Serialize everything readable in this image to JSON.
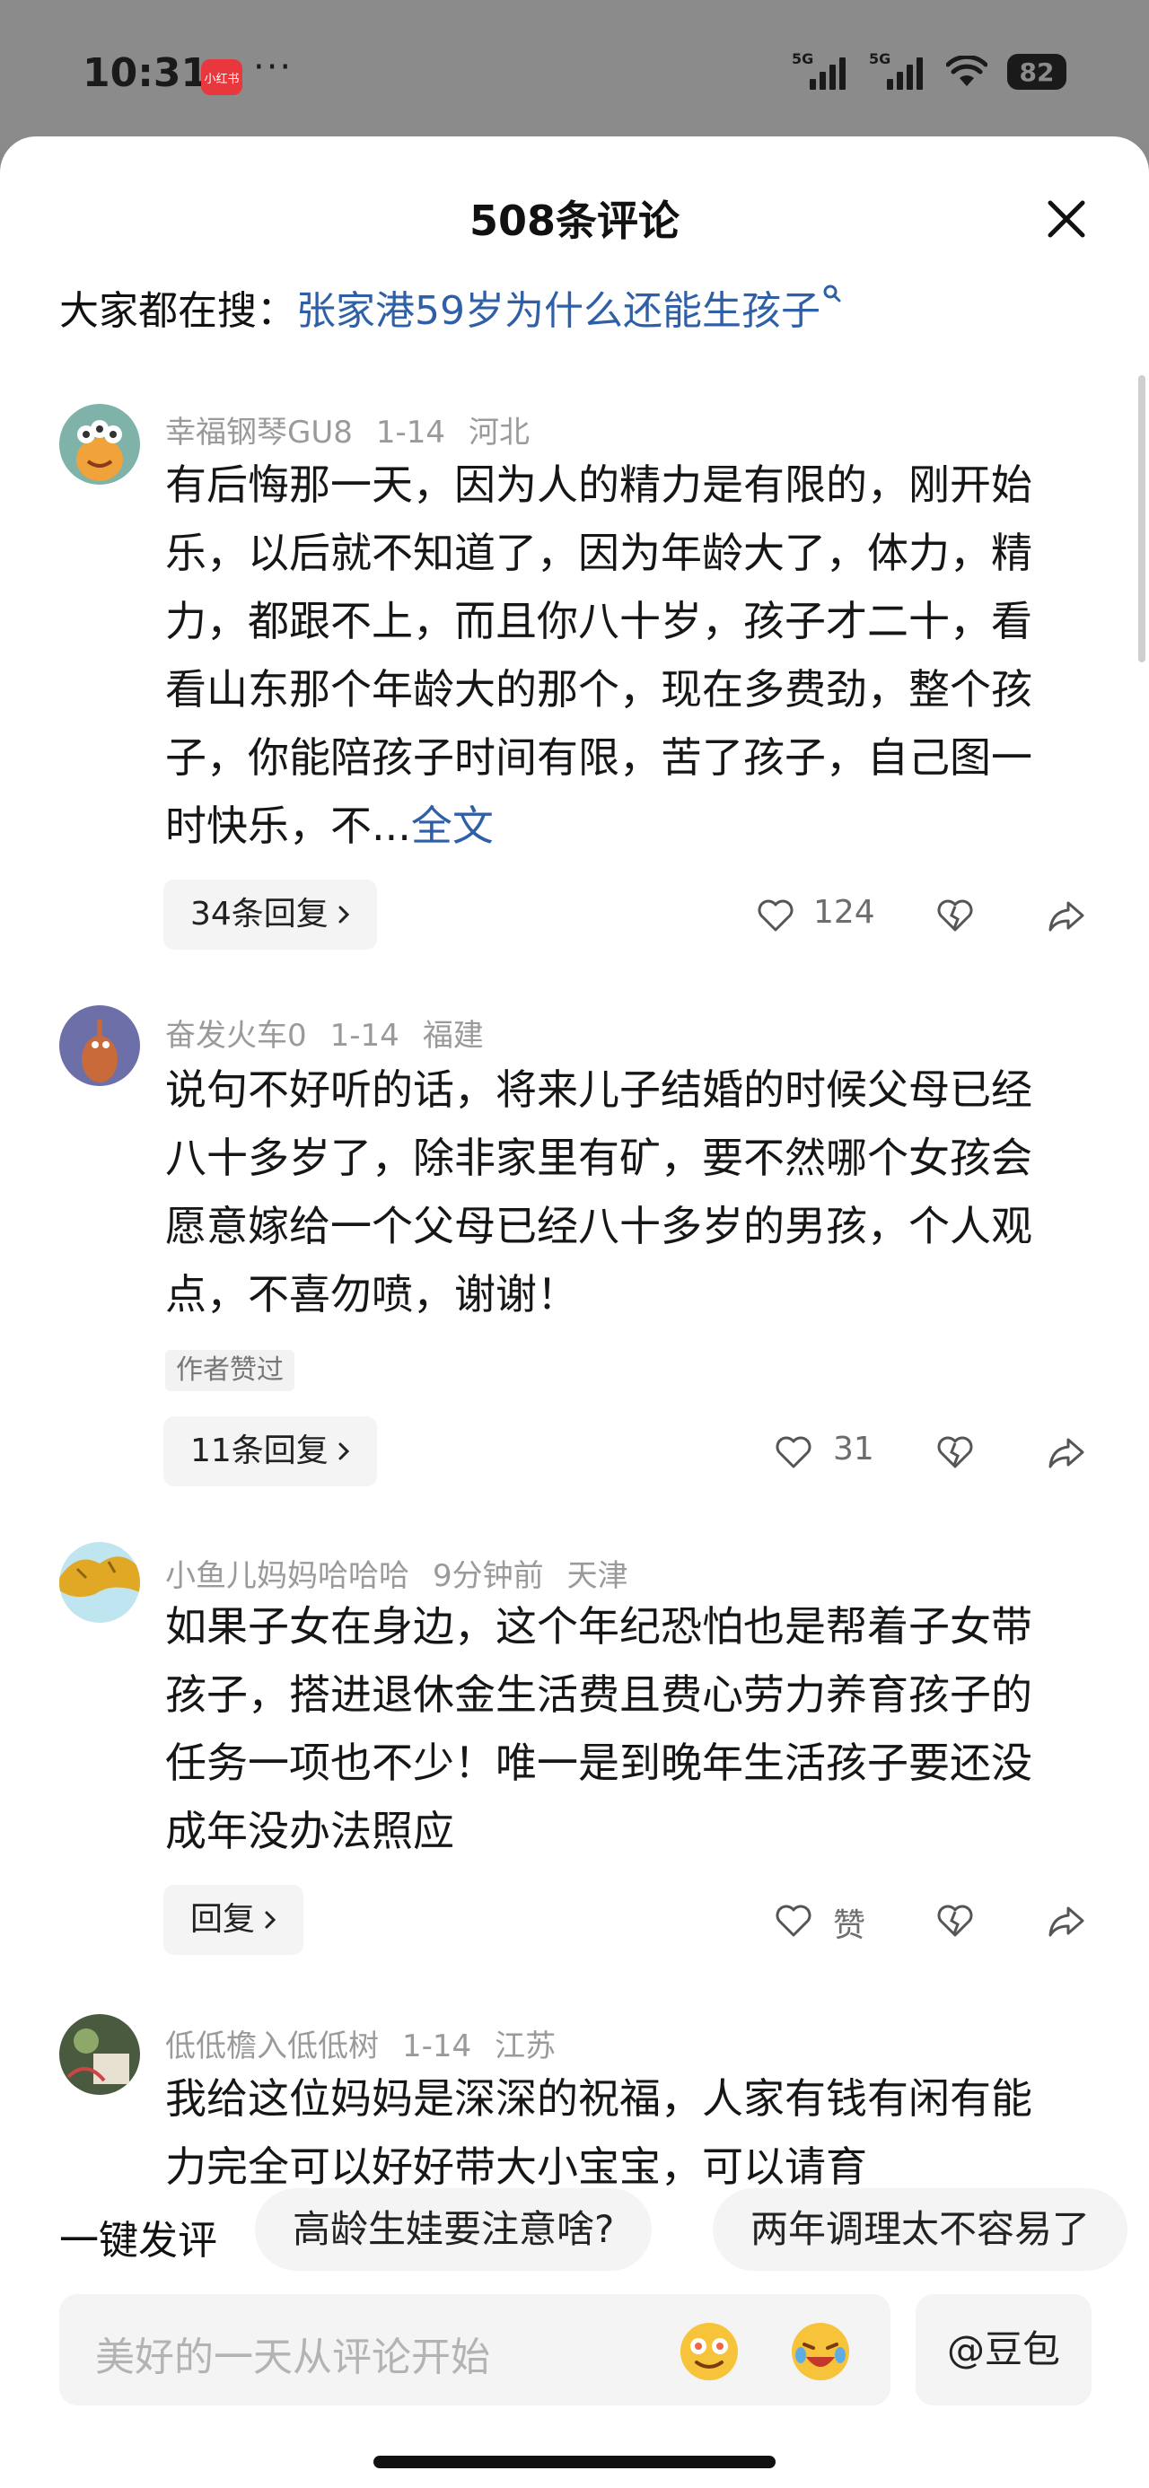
{
  "status_bar": {
    "time": "10:31",
    "app_badge": "小红书",
    "more": "···",
    "signal1_label": "5G",
    "signal2_label": "5G",
    "battery": "82"
  },
  "sheet": {
    "title": "508条评论",
    "search_prefix": "大家都在搜：",
    "search_link": "张家港59岁为什么还能生孩子"
  },
  "comments": [
    {
      "user": "幸福钢琴GU8",
      "date": "1-14",
      "location": "河北",
      "text": "有后悔那一天，因为人的精力是有限的，刚开始乐，以后就不知道了，因为年龄大了，体力，精力，都跟不上，而且你八十岁，孩子才二十，看看山东那个年龄大的那个，现在多费劲，整个孩子，你能陪孩子时间有限，苦了孩子，自己图一时快乐，不...",
      "more": "全文",
      "replies": "34条回复",
      "likes": "124"
    },
    {
      "user": "奋发火车0",
      "date": "1-14",
      "location": "福建",
      "text": "说句不好听的话，将来儿子结婚的时候父母已经八十多岁了，除非家里有矿，要不然哪个女孩会愿意嫁给一个父母已经八十多岁的男孩，个人观点，不喜勿喷，谢谢！",
      "badge": "作者赞过",
      "replies": "11条回复",
      "likes": "31"
    },
    {
      "user": "小鱼儿妈妈哈哈哈",
      "date": "9分钟前",
      "location": "天津",
      "text": "如果子女在身边，这个年纪恐怕也是帮着子女带孩子，搭进退休金生活费且费心劳力养育孩子的任务一项也不少！唯一是到晚年生活孩子要还没成年没办法照应",
      "replies": "回复",
      "likes": "赞"
    },
    {
      "user": "低低檐入低低树",
      "date": "1-14",
      "location": "江苏",
      "text": "我给这位妈妈是深深的祝福，人家有钱有闲有能力完全可以好好带大小宝宝，可以请育"
    }
  ],
  "quick_comment": {
    "label": "一键发评",
    "chips": [
      "高龄生娃要注意啥?",
      "两年调理太不容易了"
    ]
  },
  "input": {
    "placeholder": "美好的一天从评论开始",
    "doubao": "@豆包"
  },
  "colors": {
    "link": "#2f5fa6",
    "meta": "#9a9a9a",
    "chip_bg": "#f4f4f4"
  }
}
